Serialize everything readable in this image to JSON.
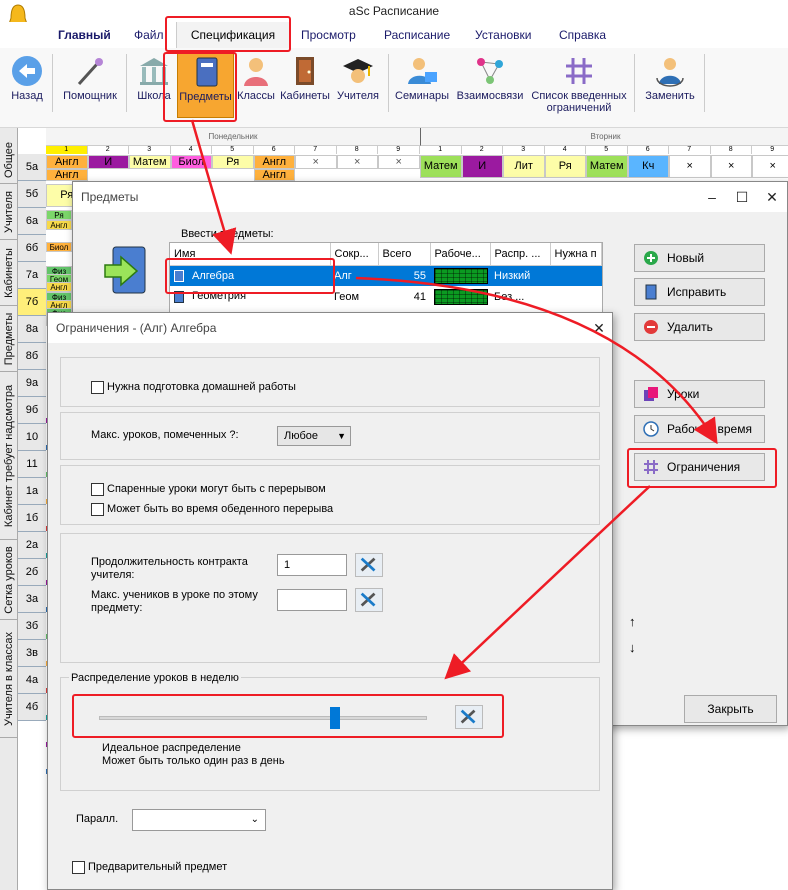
{
  "window": {
    "title": "aSc Расписание"
  },
  "menu": {
    "items": [
      "Главный",
      "Файл",
      "Спецификация",
      "Просмотр",
      "Расписание",
      "Установки",
      "Справка"
    ]
  },
  "ribbon": {
    "buttons": [
      "Назад",
      "Помощник",
      "Школа",
      "Предметы",
      "Классы",
      "Кабинеты",
      "Учителя",
      "Семинары",
      "Взаимосвязи",
      "Список введенных ограничений",
      "Заменить"
    ]
  },
  "sidetabs": [
    "Общее",
    "Учителя",
    "Кабинеты",
    "Предметы",
    "Кабинет требует надсмотра",
    "Сетка уроков",
    "Учителя в классах"
  ],
  "grid": {
    "days": [
      "Понедельник",
      "Вторник"
    ],
    "periods": [
      "1",
      "2",
      "3",
      "4",
      "5",
      "6",
      "7",
      "8",
      "9"
    ],
    "rows": [
      "5а",
      "5б",
      "6а",
      "6б",
      "7а",
      "7б",
      "8а",
      "8б",
      "9а",
      "9б",
      "10",
      "11",
      "1а",
      "1б",
      "2а",
      "2б",
      "3а",
      "3б",
      "3в",
      "4а",
      "4б"
    ],
    "row5a_mon": [
      "Англ",
      "И",
      "Матем",
      "Биол",
      "Ря",
      "Англ",
      "×",
      "×",
      "×"
    ],
    "row5a_mon_sub": [
      "Англ",
      "",
      "",
      "",
      "",
      "Англ",
      "",
      "",
      ""
    ],
    "row5a_tue": [
      "Матем",
      "И",
      "Лит",
      "Ря",
      "Матем",
      "Кч",
      "×",
      "×",
      "×"
    ],
    "row5b_first": "Ря",
    "fragments": [
      "Ря",
      "Англ",
      "Биол",
      "Физ",
      "Геом",
      "Англ",
      "Физ",
      "Англ",
      "Физ",
      "Геоп"
    ]
  },
  "subjects_dialog": {
    "title": "Предметы",
    "enter_label": "Ввести предметы:",
    "columns": [
      "Имя",
      "Сокр...",
      "Всего",
      "Рабоче...",
      "Распр. ...",
      "Нужна п"
    ],
    "rows": [
      {
        "name": "Алгебра",
        "short": "Алг",
        "total": "55",
        "dist": "Низкий"
      },
      {
        "name": "Геометрия",
        "short": "Геом",
        "total": "41",
        "dist": "Без ..."
      }
    ],
    "buttons": {
      "new": "Новый",
      "edit": "Исправить",
      "delete": "Удалить",
      "lessons": "Уроки",
      "worktime": "Рабочее время",
      "constraints": "Ограничения",
      "close": "Закрыть"
    },
    "up": "↑",
    "down": "↓"
  },
  "constraints_dialog": {
    "title": "Ограничения - (Алг) Алгебра",
    "homework": "Нужна подготовка домашней работы",
    "max_label": "Макс. уроков, помеченных ?:",
    "max_value": "Любое",
    "double_break": "Спаренные уроки могут быть с перерывом",
    "lunch": "Может быть во время обеденного перерыва",
    "contract_label": "Продолжительность контракта учителя:",
    "contract_value": "1",
    "students_label": "Макс. учеников в уроке по этому предмету:",
    "students_value": "",
    "dist_title": "Распределение уроков в неделю",
    "slider_value": 0.72,
    "dist_line1": "Идеальное распределение",
    "dist_line2": "Может быть только один раз в день",
    "parallel_label": "Паралл.",
    "parallel_value": "",
    "prelim": "Предварительный предмет"
  },
  "colors": {
    "accent_red": "#ee1c25",
    "highlight": "#f7a630",
    "selection": "#0078d7",
    "slider": "#0078d7"
  }
}
